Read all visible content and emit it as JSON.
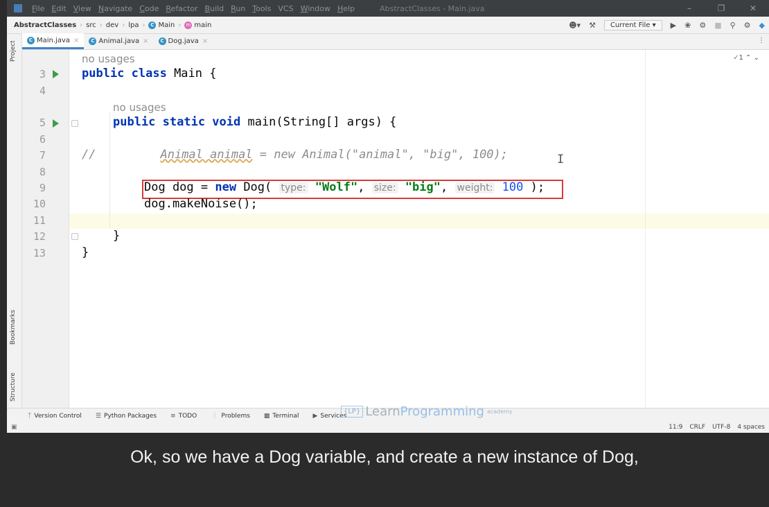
{
  "menubar": {
    "items": [
      {
        "mnemonic": "F",
        "rest": "ile"
      },
      {
        "mnemonic": "E",
        "rest": "dit"
      },
      {
        "mnemonic": "V",
        "rest": "iew"
      },
      {
        "mnemonic": "N",
        "rest": "avigate"
      },
      {
        "mnemonic": "C",
        "rest": "ode"
      },
      {
        "mnemonic": "R",
        "rest": "efactor"
      },
      {
        "mnemonic": "B",
        "rest": "uild"
      },
      {
        "mnemonic": "R",
        "rest": "un"
      },
      {
        "mnemonic": "T",
        "rest": "ools"
      },
      {
        "mnemonic": "",
        "rest": "VCS"
      },
      {
        "mnemonic": "W",
        "rest": "indow"
      },
      {
        "mnemonic": "H",
        "rest": "elp"
      }
    ],
    "title": "AbstractClasses - Main.java"
  },
  "navbar": {
    "project": "AbstractClasses",
    "crumbs": [
      "src",
      "dev",
      "lpa"
    ],
    "class_name": "Main",
    "method_name": "main",
    "run_config": "Current File"
  },
  "sidebar": {
    "project_label": "Project",
    "bookmarks_label": "Bookmarks",
    "structure_label": "Structure"
  },
  "tabs": [
    {
      "label": "Main.java"
    },
    {
      "label": "Animal.java"
    },
    {
      "label": "Dog.java"
    }
  ],
  "editor": {
    "inspection_count": "1",
    "line_numbers": [
      "3",
      "4",
      "5",
      "6",
      "7",
      "8",
      "9",
      "10",
      "11",
      "12",
      "13"
    ],
    "usage_hint_1": "no usages",
    "usage_hint_2": "no usages",
    "line3": {
      "kw": "public class",
      "rest": " Main {"
    },
    "line5": {
      "kw": "public static void",
      "rest": " main(String[] args) {"
    },
    "line7": {
      "prefix": "//",
      "code_a": "Animal animal",
      "code_b": " = new Animal(\"animal\", \"big\", 100);"
    },
    "line9": {
      "decl": "Dog dog = ",
      "kw": "new",
      "ctor": " Dog(",
      "hint_type": "type:",
      "arg1": "\"Wolf\"",
      "comma1": ",",
      "hint_size": "size:",
      "arg2": "\"big\"",
      "comma2": ",",
      "hint_weight": "weight:",
      "arg3": "100",
      "close": " );"
    },
    "line10": "dog.makeNoise();",
    "line12": "}",
    "line13": "}"
  },
  "tool_windows": [
    {
      "label": "Version Control"
    },
    {
      "label": "Python Packages"
    },
    {
      "label": "TODO"
    },
    {
      "label": "Problems"
    },
    {
      "label": "Terminal"
    },
    {
      "label": "Services"
    }
  ],
  "watermark": {
    "learn": "Learn",
    "programming": "Programming",
    "academy": "academy"
  },
  "statusbar": {
    "position": "11:9",
    "line_sep": "CRLF",
    "encoding": "UTF-8",
    "indent": "4 spaces"
  },
  "caption": "Ok, so we have a Dog variable, and create a new instance of Dog,"
}
